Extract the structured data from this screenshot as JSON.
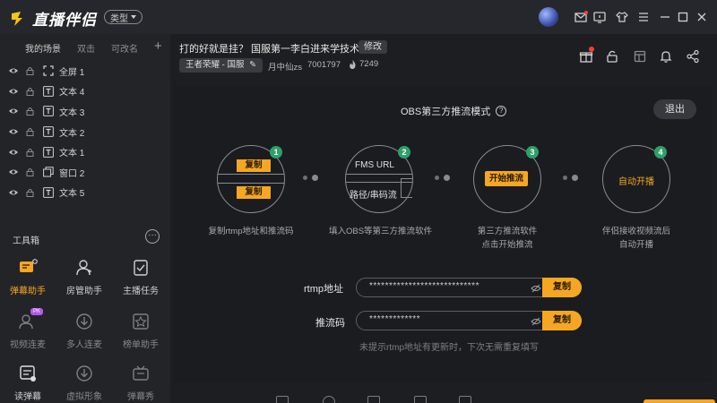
{
  "app": {
    "name": "直播伴侣",
    "type_label": "类型"
  },
  "scene_tabs": [
    "我的场景",
    "双击",
    "可改名"
  ],
  "layers": [
    {
      "label": "全屏 1",
      "kind": "fullscreen-icon"
    },
    {
      "label": "文本 4",
      "kind": "text-icon"
    },
    {
      "label": "文本 3",
      "kind": "text-icon"
    },
    {
      "label": "文本 2",
      "kind": "text-icon"
    },
    {
      "label": "文本 1",
      "kind": "text-icon"
    },
    {
      "label": "窗口 2",
      "kind": "window-icon"
    },
    {
      "label": "文本 5",
      "kind": "text-icon"
    }
  ],
  "toolbox": {
    "title": "工具箱",
    "tools": [
      {
        "label": "弹幕助手",
        "icon": "danmaku-icon",
        "state": "active"
      },
      {
        "label": "房管助手",
        "icon": "moderator-icon",
        "state": "normal"
      },
      {
        "label": "主播任务",
        "icon": "task-icon",
        "state": "normal"
      },
      {
        "label": "视频连麦",
        "icon": "video-link-icon",
        "state": "dim",
        "badge": "PK"
      },
      {
        "label": "多人连麦",
        "icon": "multi-link-icon",
        "state": "dim"
      },
      {
        "label": "榜单助手",
        "icon": "ranking-icon",
        "state": "dim"
      },
      {
        "label": "读弹幕",
        "icon": "read-danmaku-icon",
        "state": "normal"
      },
      {
        "label": "虚拟形象",
        "icon": "avatar-icon",
        "state": "dim"
      },
      {
        "label": "弹幕秀",
        "icon": "danmaku-show-icon",
        "state": "dim"
      }
    ]
  },
  "stream": {
    "title": "打的好就是挂？ 国服第一李白进来学技术",
    "edit_label": "修改",
    "category": "王者荣耀 - 国服",
    "streamer": "月中仙zs",
    "room_id": "7001797",
    "heat": "7249"
  },
  "obs": {
    "title": "OBS第三方推流模式",
    "exit_label": "退出",
    "steps": [
      {
        "num": "1",
        "desc": "复制rtmp地址和推流码",
        "tag1": "复制",
        "tag2": "复制"
      },
      {
        "num": "2",
        "desc": "填入OBS等第三方推流软件",
        "line1": "FMS URL",
        "line2": "路径/串码流"
      },
      {
        "num": "3",
        "desc": "第三方推流软件",
        "desc2": "点击开始推流",
        "tag1": "开始推流"
      },
      {
        "num": "4",
        "desc": "伴侣接收视频流后",
        "desc2": "自动开播",
        "tag1": "自动开播"
      }
    ],
    "rtmp_label": "rtmp地址",
    "rtmp_value": "****************************",
    "key_label": "推流码",
    "key_value": "*************",
    "copy_label": "复制",
    "hint": "未提示rtmp地址有更新时，下次无需重复填写"
  },
  "colors": {
    "accent": "#f5a623",
    "step_badge": "#2ea06a",
    "background": "#1d1e22"
  }
}
